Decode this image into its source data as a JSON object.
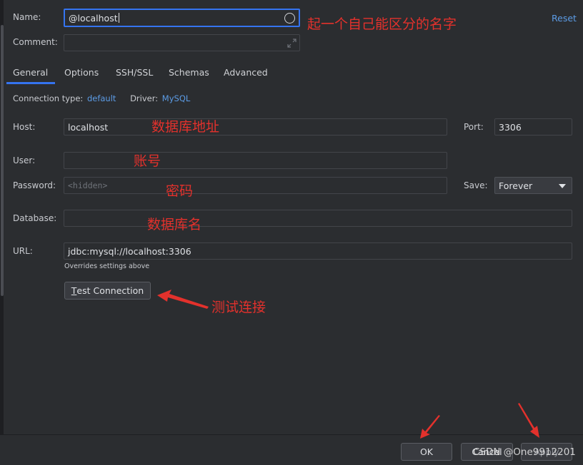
{
  "header": {
    "name_label": "Name:",
    "name_value": "@localhost",
    "reset_label": "Reset",
    "comment_label": "Comment:"
  },
  "tabs": [
    {
      "label": "General",
      "active": true
    },
    {
      "label": "Options",
      "active": false
    },
    {
      "label": "SSH/SSL",
      "active": false
    },
    {
      "label": "Schemas",
      "active": false
    },
    {
      "label": "Advanced",
      "active": false
    }
  ],
  "connection": {
    "type_label": "Connection type:",
    "type_value": "default",
    "driver_label": "Driver:",
    "driver_value": "MySQL"
  },
  "form": {
    "host_label": "Host:",
    "host_value": "localhost",
    "port_label": "Port:",
    "port_value": "3306",
    "user_label": "User:",
    "user_value": "",
    "password_label": "Password:",
    "password_placeholder": "<hidden>",
    "save_label": "Save:",
    "save_value": "Forever",
    "database_label": "Database:",
    "database_value": "",
    "url_label": "URL:",
    "url_value": "jdbc:mysql://localhost:3306",
    "url_hint": "Overrides settings above",
    "test_button_mnemonic": "T",
    "test_button_rest": "est Connection"
  },
  "annotations": {
    "name": "起一个自己能区分的名字",
    "host": "数据库地址",
    "user": "账号",
    "password": "密码",
    "database": "数据库名",
    "test": "测试连接"
  },
  "footer": {
    "ok_label": "OK",
    "cancel_label": "Cancel",
    "apply_label": "Apply",
    "watermark": "CSDN @One9912201"
  },
  "colors": {
    "background": "#2b2d30",
    "accent": "#3574f0",
    "link": "#5c9ce6",
    "annotation": "#e3312c"
  }
}
